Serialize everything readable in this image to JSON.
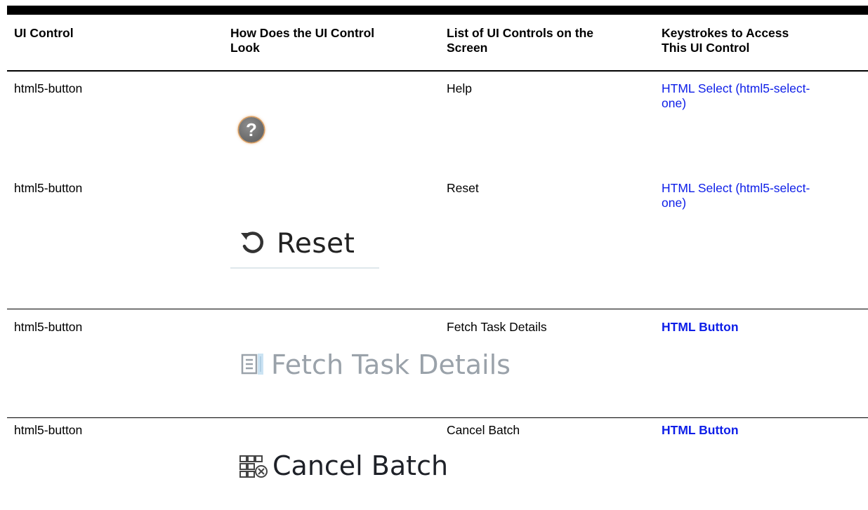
{
  "table": {
    "headers": {
      "ui_control": "UI Control",
      "look_line1": "How Does the UI Control",
      "look_line2": "Look",
      "list_line1": "List of UI Controls on the",
      "list_line2": "Screen",
      "keys_line1": "Keystrokes to Access",
      "keys_line2": "This UI Control"
    },
    "rows": [
      {
        "control": "html5-button",
        "image_label": "?",
        "image_icon": "help-icon",
        "name": "Help",
        "link_line1": "HTML Select (html5-select-",
        "link_line2": "one)"
      },
      {
        "control": "html5-button",
        "image_label": "Reset",
        "image_icon": "reset-arrow-icon",
        "name": "Reset",
        "link_line1": "HTML Select (html5-select-",
        "link_line2": "one)"
      },
      {
        "control": "html5-button",
        "image_label": "Fetch Task Details",
        "image_icon": "task-details-icon",
        "name": "Fetch Task Details",
        "link": "HTML Button"
      },
      {
        "control": "html5-button",
        "image_label": "Cancel Batch",
        "image_icon": "cancel-batch-icon",
        "name": "Cancel Batch",
        "link": "HTML Button"
      }
    ]
  },
  "colors": {
    "link": "#0d1ee8",
    "text": "#000000",
    "rule": "#000000"
  }
}
